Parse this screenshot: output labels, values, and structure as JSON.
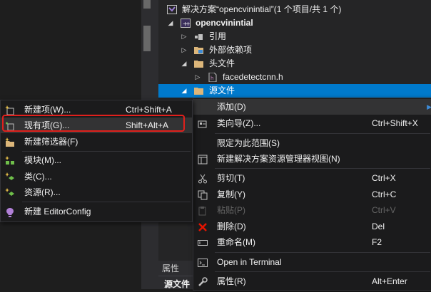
{
  "solution_explorer": {
    "solution_label": "解决方案“opencvinintial”(1 个项目/共 1 个)",
    "project_label": "opencvinintial",
    "nodes": [
      {
        "label": "引用"
      },
      {
        "label": "外部依赖项"
      },
      {
        "label": "头文件"
      },
      {
        "label": "facedetectcnn.h"
      },
      {
        "label": "源文件"
      }
    ]
  },
  "context_menu": {
    "items": [
      {
        "label": "添加(D)",
        "shortcut": "",
        "icon": "none"
      },
      {
        "label": "类向导(Z)...",
        "shortcut": "Ctrl+Shift+X",
        "icon": "class-wizard-icon"
      },
      {
        "label": "限定为此范围(S)",
        "shortcut": "",
        "icon": "none"
      },
      {
        "label": "新建解决方案资源管理器视图(N)",
        "shortcut": "",
        "icon": "new-view-icon"
      },
      {
        "label": "剪切(T)",
        "shortcut": "Ctrl+X",
        "icon": "scissors-icon"
      },
      {
        "label": "复制(Y)",
        "shortcut": "Ctrl+C",
        "icon": "copy-icon"
      },
      {
        "label": "粘贴(P)",
        "shortcut": "Ctrl+V",
        "icon": "paste-icon"
      },
      {
        "label": "删除(D)",
        "shortcut": "Del",
        "icon": "delete-icon"
      },
      {
        "label": "重命名(M)",
        "shortcut": "F2",
        "icon": "rename-icon"
      },
      {
        "label": "Open in Terminal",
        "shortcut": "",
        "icon": "terminal-icon"
      },
      {
        "label": "属性(R)",
        "shortcut": "Alt+Enter",
        "icon": "wrench-icon"
      }
    ]
  },
  "add_submenu": {
    "items": [
      {
        "label": "新建项(W)...",
        "shortcut": "Ctrl+Shift+A",
        "icon": "new-item-icon"
      },
      {
        "label": "现有项(G)...",
        "shortcut": "Shift+Alt+A",
        "icon": "existing-item-icon"
      },
      {
        "label": "新建筛选器(F)",
        "shortcut": "",
        "icon": "new-filter-icon"
      },
      {
        "label": "模块(M)...",
        "shortcut": "",
        "icon": "module-icon"
      },
      {
        "label": "类(C)...",
        "shortcut": "",
        "icon": "class-icon"
      },
      {
        "label": "资源(R)...",
        "shortcut": "",
        "icon": "resource-icon"
      },
      {
        "label": "新建 EditorConfig",
        "shortcut": "",
        "icon": "editorconfig-icon"
      }
    ]
  },
  "properties_panel": {
    "header": "属性",
    "value": "源文件"
  },
  "colors": {
    "selection": "#007acc",
    "highlight_box": "#e0201c",
    "menu_bg": "#1b1b1c",
    "folder": "#dcb67a"
  }
}
